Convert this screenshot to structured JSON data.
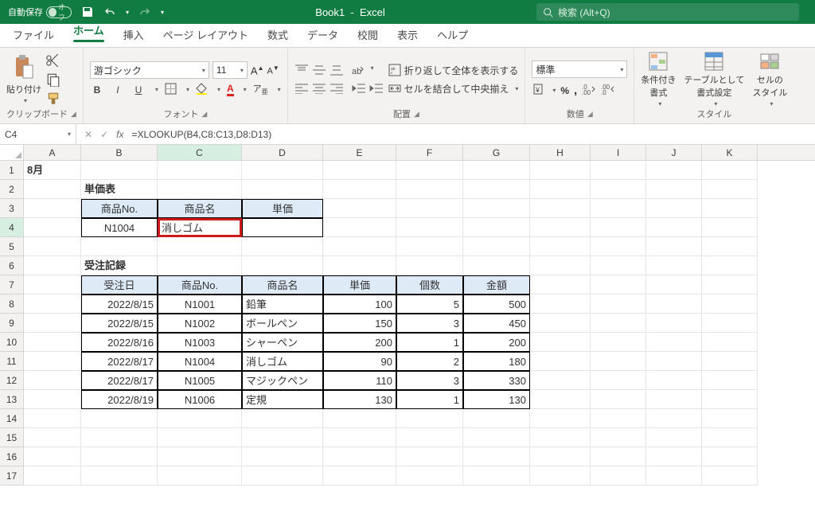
{
  "title": {
    "autosave_label": "自動保存",
    "autosave_state": "オフ",
    "doc": "Book1",
    "app": "Excel",
    "search_placeholder": "検索 (Alt+Q)"
  },
  "tabs": {
    "file": "ファイル",
    "home": "ホーム",
    "insert": "挿入",
    "layout": "ページ レイアウト",
    "formulas": "数式",
    "data": "データ",
    "review": "校閲",
    "view": "表示",
    "help": "ヘルプ"
  },
  "ribbon": {
    "clipboard": {
      "paste": "貼り付け",
      "group": "クリップボード"
    },
    "font": {
      "name": "游ゴシック",
      "size": "11",
      "group": "フォント",
      "bold": "B",
      "italic": "I",
      "underline": "U"
    },
    "align": {
      "wrap": "折り返して全体を表示する",
      "merge": "セルを結合して中央揃え",
      "group": "配置"
    },
    "number": {
      "format": "標準",
      "group": "数値"
    },
    "styles": {
      "cond": "条件付き\n書式",
      "table": "テーブルとして\n書式設定",
      "cell": "セルの\nスタイル",
      "group": "スタイル"
    }
  },
  "namebox": "C4",
  "formula": "=XLOOKUP(B4,C8:C13,D8:D13)",
  "cols": [
    "A",
    "B",
    "C",
    "D",
    "E",
    "F",
    "G",
    "H",
    "I",
    "J",
    "K"
  ],
  "sheet": {
    "a1": "8月",
    "t1": {
      "title": "単価表",
      "h": [
        "商品No.",
        "商品名",
        "単価"
      ],
      "r": [
        "N1004",
        "消しゴム",
        ""
      ]
    },
    "t2": {
      "title": "受注記録",
      "h": [
        "受注日",
        "商品No.",
        "商品名",
        "単価",
        "個数",
        "金額"
      ],
      "rows": [
        [
          "2022/8/15",
          "N1001",
          "鉛筆",
          "100",
          "5",
          "500"
        ],
        [
          "2022/8/15",
          "N1002",
          "ボールペン",
          "150",
          "3",
          "450"
        ],
        [
          "2022/8/16",
          "N1003",
          "シャーペン",
          "200",
          "1",
          "200"
        ],
        [
          "2022/8/17",
          "N1004",
          "消しゴム",
          "90",
          "2",
          "180"
        ],
        [
          "2022/8/17",
          "N1005",
          "マジックペン",
          "110",
          "3",
          "330"
        ],
        [
          "2022/8/19",
          "N1006",
          "定規",
          "130",
          "1",
          "130"
        ]
      ]
    }
  }
}
